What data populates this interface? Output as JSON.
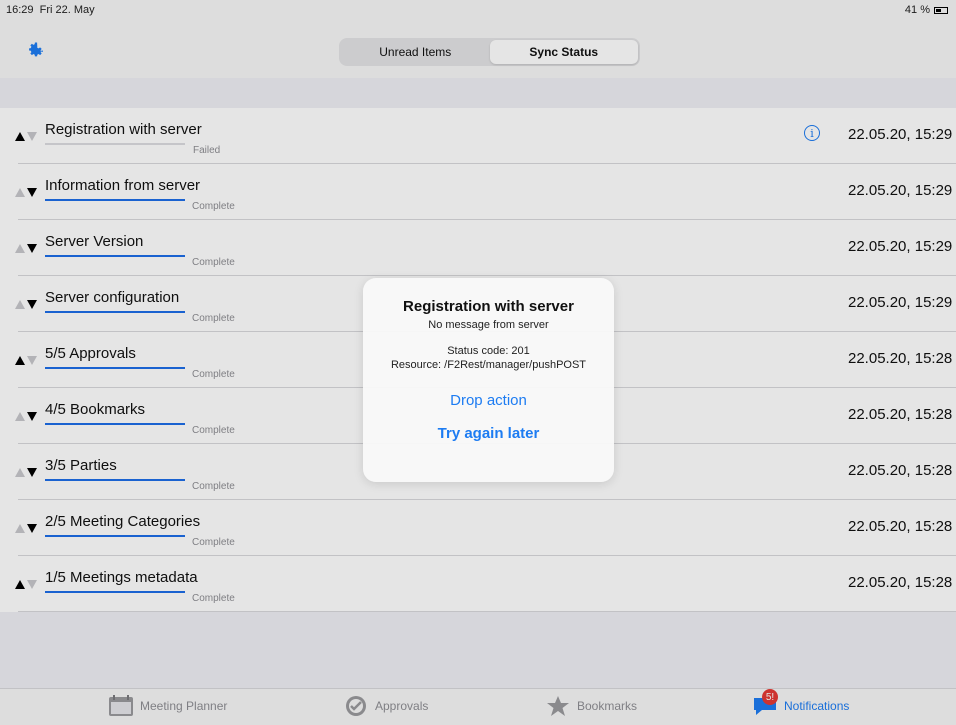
{
  "status_bar": {
    "time": "16:29",
    "date": "Fri 22. May",
    "battery": "41 %"
  },
  "navbar": {
    "settings_icon": "gear-icon",
    "segments": [
      {
        "label": "Unread Items",
        "active": false
      },
      {
        "label": "Sync Status",
        "active": true
      }
    ]
  },
  "rows": [
    {
      "title": "Registration with server",
      "status": "Failed",
      "time": "22.05.20, 15:29",
      "direction": "up",
      "info": true
    },
    {
      "title": "Information from server",
      "status": "Complete",
      "time": "22.05.20, 15:29",
      "direction": "down"
    },
    {
      "title": "Server Version",
      "status": "Complete",
      "time": "22.05.20, 15:29",
      "direction": "down"
    },
    {
      "title": "Server configuration",
      "status": "Complete",
      "time": "22.05.20, 15:29",
      "direction": "down"
    },
    {
      "title": "5/5 Approvals",
      "status": "Complete",
      "time": "22.05.20, 15:28",
      "direction": "up"
    },
    {
      "title": "4/5 Bookmarks",
      "status": "Complete",
      "time": "22.05.20, 15:28",
      "direction": "down"
    },
    {
      "title": "3/5 Parties",
      "status": "Complete",
      "time": "22.05.20, 15:28",
      "direction": "down"
    },
    {
      "title": "2/5 Meeting Categories",
      "status": "Complete",
      "time": "22.05.20, 15:28",
      "direction": "down"
    },
    {
      "title": "1/5 Meetings metadata",
      "status": "Complete",
      "time": "22.05.20, 15:28",
      "direction": "up"
    }
  ],
  "alert": {
    "title": "Registration with server",
    "subtitle": "No message from server",
    "status_code": "Status code: 201",
    "resource": "Resource: /F2Rest/manager/pushPOST",
    "button_drop": "Drop action",
    "button_retry": "Try again later"
  },
  "tabbar": {
    "tabs": [
      {
        "label": "Meeting Planner",
        "icon": "calendar-icon"
      },
      {
        "label": "Approvals",
        "icon": "checkmark-badge-icon"
      },
      {
        "label": "Bookmarks",
        "icon": "star-icon"
      },
      {
        "label": "Notifications",
        "icon": "chat-bubble-icon",
        "badge": "5!",
        "active": true
      }
    ]
  },
  "colors": {
    "accent": "#1d7cf2",
    "badge": "#e53935"
  }
}
